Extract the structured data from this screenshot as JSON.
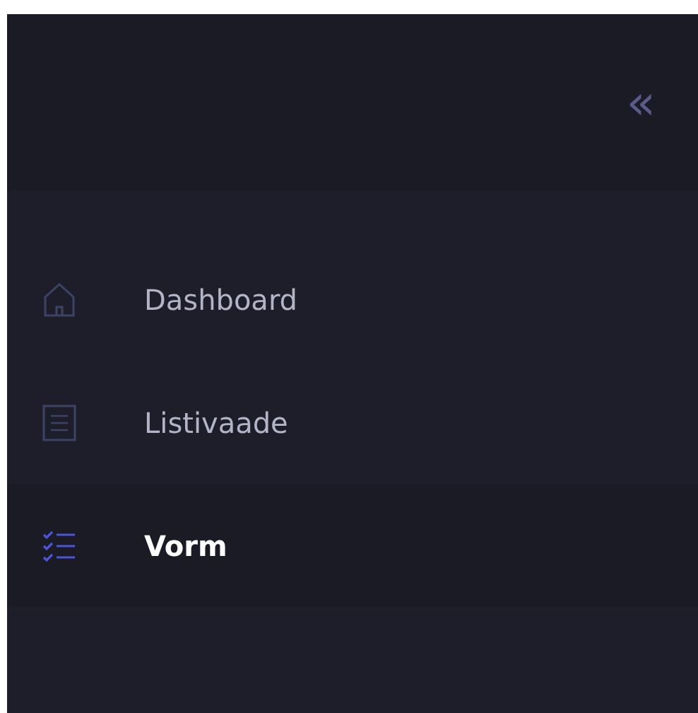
{
  "sidebar": {
    "collapse_button": {
      "label": "«"
    },
    "items": [
      {
        "kind": "home",
        "label": "Dashboard",
        "selected": false
      },
      {
        "kind": "list",
        "label": "Listivaade",
        "selected": false
      },
      {
        "kind": "checklist",
        "label": "Vorm",
        "selected": true
      }
    ]
  }
}
